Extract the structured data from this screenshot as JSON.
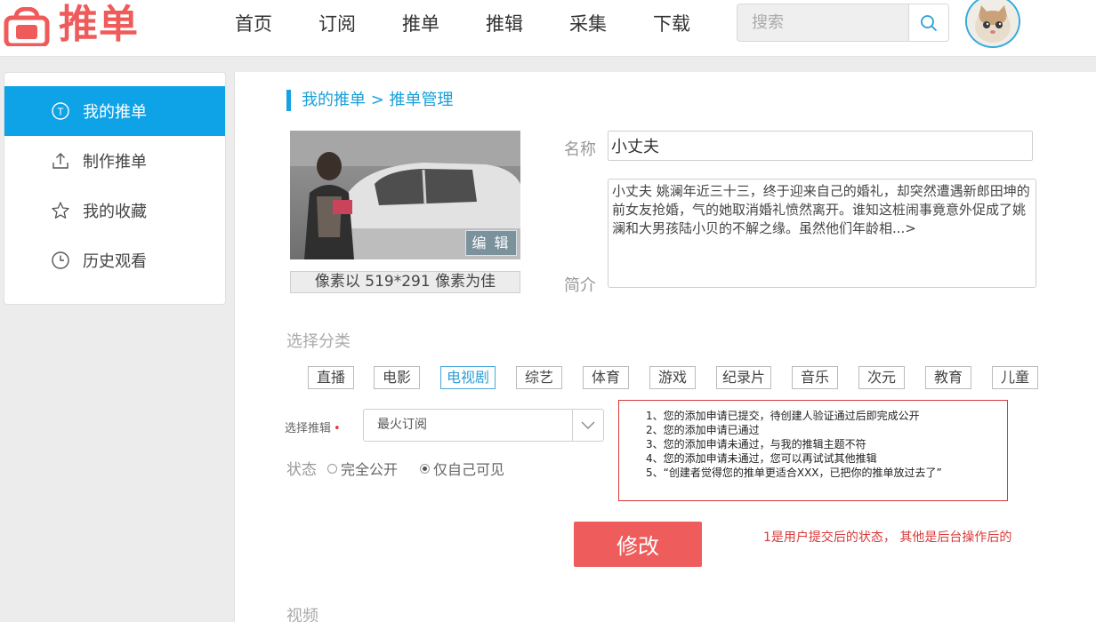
{
  "header": {
    "logo_text": "推单",
    "nav": [
      "首页",
      "订阅",
      "推单",
      "推辑",
      "采集",
      "下载"
    ],
    "search_placeholder": "搜索"
  },
  "sidebar": {
    "items": [
      {
        "label": "我的推单",
        "icon": "t-circle-icon",
        "active": true
      },
      {
        "label": "制作推单",
        "icon": "upload-icon",
        "active": false
      },
      {
        "label": "我的收藏",
        "icon": "star-icon",
        "active": false
      },
      {
        "label": "历史观看",
        "icon": "clock-icon",
        "active": false
      }
    ]
  },
  "breadcrumb": {
    "root": "我的推单",
    "separator": " > ",
    "current": "推单管理"
  },
  "cover": {
    "edit_label": "编 辑",
    "tip": "像素以 519*291 像素为佳"
  },
  "form": {
    "name_label": "名称",
    "name_value": "小丈夫",
    "intro_label": "简介",
    "intro_value": "小丈夫 姚澜年近三十三，终于迎来自己的婚礼，却突然遭遇新郎田坤的前女友抢婚，气的她取消婚礼愤然离开。谁知这桩闹事竟意外促成了姚澜和大男孩陆小贝的不解之缘。虽然他们年龄相...>",
    "category_label": "选择分类",
    "categories": [
      "直播",
      "电影",
      "电视剧",
      "综艺",
      "体育",
      "游戏",
      "纪录片",
      "音乐",
      "次元",
      "教育",
      "儿童"
    ],
    "active_category": "电视剧",
    "album_label": "选择推辑",
    "album_required_mark": "•",
    "album_value": "最火订阅",
    "status_label": "状态",
    "status_options": [
      {
        "label": "完全公开",
        "selected": false
      },
      {
        "label": "仅自己可见",
        "selected": true
      }
    ],
    "submit_label": "修改",
    "video_label": "视频"
  },
  "notes": [
    "1、您的添加申请已提交，待创建人验证通过后即完成公开",
    "2、您的添加申请已通过",
    "3、您的添加申请未通过，与我的推辑主题不符",
    "4、您的添加申请未通过，您可以再试试其他推辑",
    "5、“创建者觉得您的推单更适合XXX，已把你的推单放过去了”"
  ],
  "annotation": "1是用户提交后的状态， 其他是后台操作后的",
  "colors": {
    "brand_red": "#ef5b5b",
    "sidebar_active": "#0ea2e6",
    "accent_blue": "#189fd8",
    "note_border": "#d53b3b"
  }
}
